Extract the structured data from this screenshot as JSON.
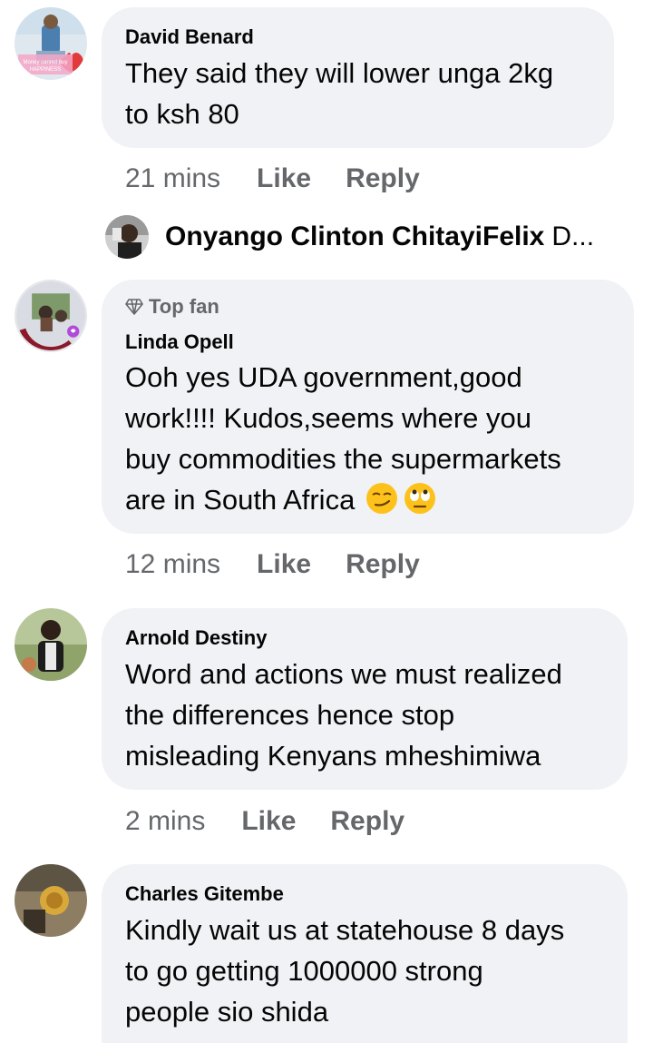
{
  "comments": [
    {
      "author": "David Benard",
      "lines": [
        "They said they will lower unga 2kg",
        "to ksh 80"
      ],
      "time": "21 mins",
      "like": "Like",
      "reply": "Reply",
      "avatar_caption": [
        "Money cannot buy",
        "HAPPINESS"
      ]
    },
    {
      "badge": "Top fan",
      "author": "Linda Opell",
      "lines": [
        "Ooh yes UDA government,good",
        "work!!!! Kudos,seems where you",
        "buy commodities the supermarkets",
        "are in South Africa"
      ],
      "emojis": [
        "smirking-face-emoji",
        "eye-roll-emoji"
      ],
      "time": "12 mins",
      "like": "Like",
      "reply": "Reply",
      "avatar_caption": "I'VE HAD MY COVID-19 VACCINE"
    },
    {
      "author": "Arnold Destiny",
      "lines": [
        "Word and actions we must realized",
        "the differences hence stop",
        "misleading Kenyans mheshimiwa"
      ],
      "time": "2 mins",
      "like": "Like",
      "reply": "Reply"
    },
    {
      "author": "Charles Gitembe",
      "lines": [
        "Kindly wait us at statehouse 8 days",
        "to go getting 1000000  strong",
        "people sio shida"
      ]
    }
  ],
  "reply_preview": {
    "name": "Onyango Clinton ChitayiFelix",
    "rest": "D..."
  },
  "colors": {
    "bubble": "#f0f2f5",
    "meta_text": "#65676b",
    "text": "#050505"
  }
}
